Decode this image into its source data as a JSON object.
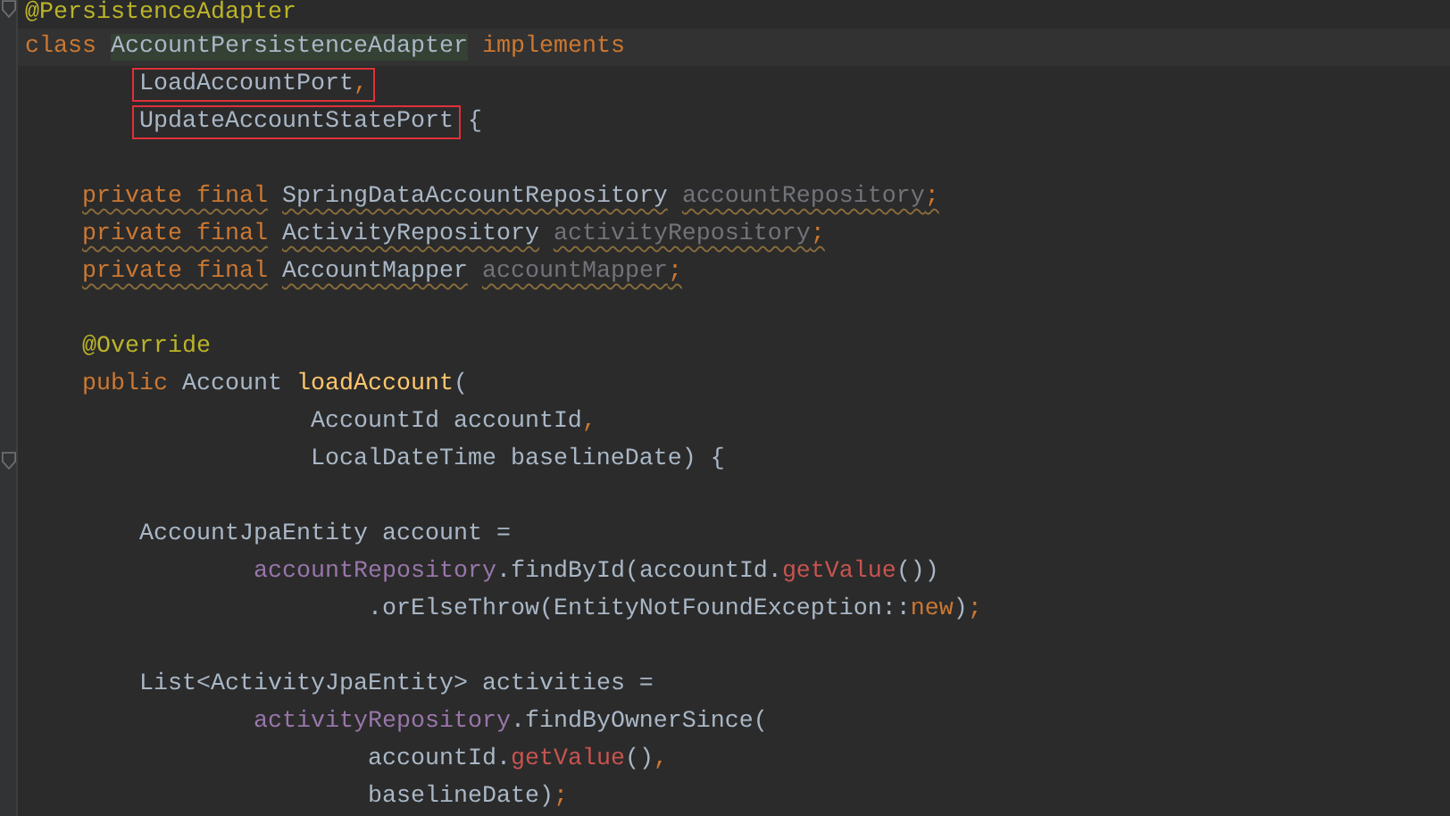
{
  "editor": {
    "lines": [
      {
        "fold_marker": true,
        "tokens": [
          {
            "text": "@PersistenceAdapter",
            "kind": "annotation"
          }
        ]
      },
      {
        "current": true,
        "tokens": [
          {
            "text": "class",
            "kind": "keyword"
          },
          {
            "text": " AccountPersistenceAdapter",
            "kind": "plain",
            "highlighted": true
          },
          {
            "text": " implements",
            "kind": "keyword"
          }
        ]
      },
      {
        "tokens": [
          {
            "text": "        LoadAccountPort",
            "kind": "plain",
            "framed": true
          },
          {
            "text": ",",
            "kind": "keyword",
            "framed": true
          }
        ]
      },
      {
        "tokens": [
          {
            "text": "        UpdateAccountStatePort",
            "kind": "plain",
            "framed": true
          },
          {
            "text": " {",
            "kind": "plain"
          }
        ]
      },
      {
        "blank_line_before": true,
        "warning": true,
        "tokens": [
          {
            "text": "    private final",
            "kind": "keyword"
          },
          {
            "text": " SpringDataAccountRepository",
            "kind": "plain"
          },
          {
            "text": " accountRepository",
            "kind": "unused"
          },
          {
            "text": ";",
            "kind": "keyword"
          }
        ]
      },
      {
        "warning": true,
        "tokens": [
          {
            "text": "    private final",
            "kind": "keyword"
          },
          {
            "text": " ActivityRepository",
            "kind": "plain"
          },
          {
            "text": " activityRepository",
            "kind": "unused"
          },
          {
            "text": ";",
            "kind": "keyword"
          }
        ]
      },
      {
        "warning": true,
        "tokens": [
          {
            "text": "    private final",
            "kind": "keyword"
          },
          {
            "text": " AccountMapper",
            "kind": "plain"
          },
          {
            "text": " accountMapper",
            "kind": "unused"
          },
          {
            "text": ";",
            "kind": "keyword"
          }
        ]
      },
      {
        "blank_line_before": true,
        "tokens": [
          {
            "text": "    @Override",
            "kind": "annotation"
          }
        ]
      },
      {
        "tokens": [
          {
            "text": "    public",
            "kind": "keyword"
          },
          {
            "text": " Account",
            "kind": "plain"
          },
          {
            "text": " loadAccount",
            "kind": "declaration"
          },
          {
            "text": "(",
            "kind": "plain"
          }
        ]
      },
      {
        "tokens": [
          {
            "text": "                    AccountId accountId",
            "kind": "plain"
          },
          {
            "text": ",",
            "kind": "keyword"
          }
        ]
      },
      {
        "fold_marker": true,
        "tokens": [
          {
            "text": "                    LocalDateTime baselineDate) {",
            "kind": "plain"
          }
        ]
      },
      {
        "blank_line_before": true,
        "tokens": [
          {
            "text": "        AccountJpaEntity account =",
            "kind": "plain"
          }
        ]
      },
      {
        "tokens": [
          {
            "text": "                accountRepository",
            "kind": "field"
          },
          {
            "text": ".findById(accountId.",
            "kind": "plain"
          },
          {
            "text": "getValue",
            "kind": "call"
          },
          {
            "text": "())",
            "kind": "plain"
          }
        ]
      },
      {
        "tokens": [
          {
            "text": "                        .orElseThrow(EntityNotFoundException::",
            "kind": "plain"
          },
          {
            "text": "new",
            "kind": "keyword"
          },
          {
            "text": ")",
            "kind": "plain"
          },
          {
            "text": ";",
            "kind": "keyword"
          }
        ]
      },
      {
        "blank_line_before": true,
        "tokens": [
          {
            "text": "        List<ActivityJpaEntity> activities =",
            "kind": "plain"
          }
        ]
      },
      {
        "tokens": [
          {
            "text": "                activityRepository",
            "kind": "field"
          },
          {
            "text": ".findByOwnerSince(",
            "kind": "plain"
          }
        ]
      },
      {
        "tokens": [
          {
            "text": "                        accountId.",
            "kind": "plain"
          },
          {
            "text": "getValue",
            "kind": "call"
          },
          {
            "text": "()",
            "kind": "plain"
          },
          {
            "text": ",",
            "kind": "keyword"
          }
        ]
      },
      {
        "tokens": [
          {
            "text": "                        baselineDate)",
            "kind": "plain"
          },
          {
            "text": ";",
            "kind": "keyword"
          }
        ]
      }
    ]
  }
}
